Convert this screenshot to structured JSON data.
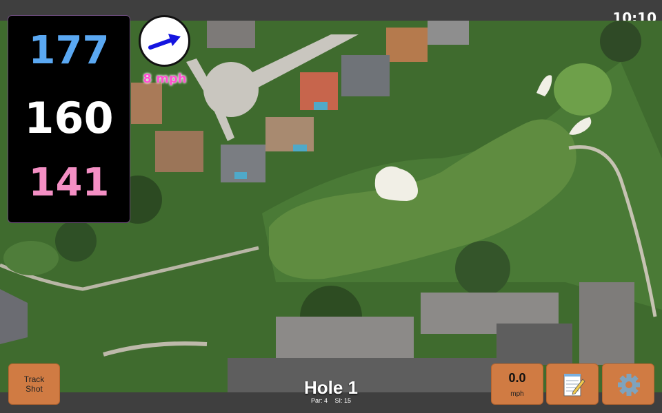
{
  "status": {
    "time": "10:10"
  },
  "distances": {
    "back": "177",
    "middle": "160",
    "front": "141"
  },
  "wind": {
    "speed_label": "8 mph",
    "icon": "arrow-icon"
  },
  "hole": {
    "title": "Hole 1",
    "par_label": "Par: 4",
    "si_label": "SI: 15"
  },
  "buttons": {
    "track_shot_line1": "Track",
    "track_shot_line2": "Shot",
    "speed_value": "0.0",
    "speed_unit": "mph",
    "notes_icon": "notepad-icon",
    "settings_icon": "gear-icon"
  },
  "colors": {
    "back_distance": "#5aa8f2",
    "middle_distance": "#ffffff",
    "front_distance": "#f48fc4",
    "button": "#d07b43",
    "wind_speed": "#ff4fd0"
  }
}
